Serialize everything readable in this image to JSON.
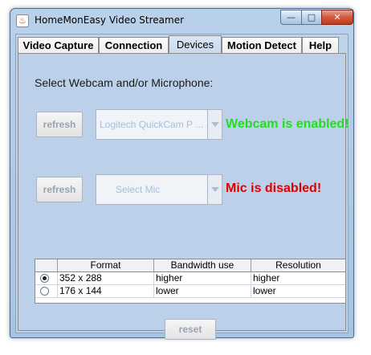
{
  "window": {
    "title": "HomeMonEasy Video Streamer",
    "icon": "java-cup-icon",
    "controls": {
      "minimize": "—",
      "maximize": "□",
      "close": "✕"
    }
  },
  "tabs": [
    {
      "label": "Video Capture",
      "active": false
    },
    {
      "label": "Connection",
      "active": false
    },
    {
      "label": "Devices",
      "active": true
    },
    {
      "label": "Motion Detect",
      "active": false
    },
    {
      "label": "Help",
      "active": false
    }
  ],
  "devices": {
    "prompt": "Select Webcam and/or Microphone:",
    "webcam": {
      "refresh_label": "refresh",
      "selected": "Logitech QuickCam P ...",
      "status": "Webcam is enabled!",
      "status_color": "#22dd22"
    },
    "mic": {
      "refresh_label": "refresh",
      "selected": "Select Mic",
      "status": "Mic is disabled!",
      "status_color": "#e00000"
    },
    "formats": {
      "columns": [
        "Format",
        "Bandwidth use",
        "Resolution"
      ],
      "rows": [
        {
          "selected": true,
          "format": "352 x 288",
          "bandwidth": "higher",
          "resolution": "higher"
        },
        {
          "selected": false,
          "format": "176 x 144",
          "bandwidth": "lower",
          "resolution": "lower"
        }
      ]
    },
    "reset_label": "reset"
  },
  "colors": {
    "window_frame": "#b9d1ea",
    "panel": "#bcd0e9",
    "disabled_text": "#9aa4ae"
  }
}
